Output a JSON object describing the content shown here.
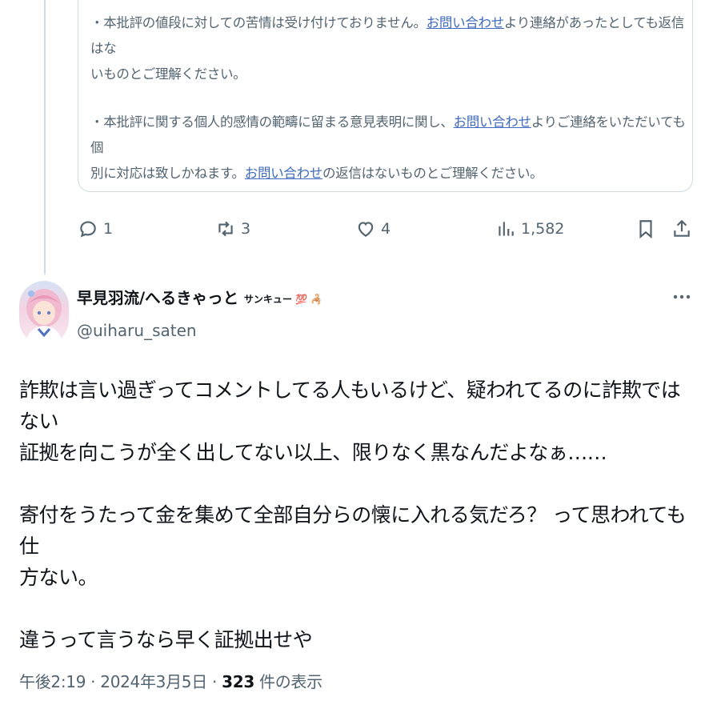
{
  "quoted_card": {
    "paragraph1": {
      "before": "・本批評の値段に対しての苦情は受け付けておりません。",
      "link": "お問い合わせ",
      "after_line1": "より連絡があったとしても返信はな",
      "line2": "いものとご理解ください。"
    },
    "paragraph2": {
      "before": "・本批評に関する個人的感情の範疇に留まる意見表明に関し、",
      "link1": "お問い合わせ",
      "after_line1": "よりご連絡をいただいても個",
      "line2_before": "別に対応は致しかねます。",
      "link2": "お問い合わせ",
      "line2_after": "の返信はないものとご理解ください。"
    }
  },
  "actions": {
    "reply_count": "1",
    "repost_count": "3",
    "like_count": "4",
    "views_count": "1,582"
  },
  "tweet": {
    "display_name": "早見羽流/へるきゃっと",
    "name_emoji": "サンキュー 💯 🦂",
    "handle": "@uiharu_saten",
    "paragraphs": [
      [
        "詐欺は言い過ぎってコメントしてる人もいるけど、疑われてるのに詐欺ではない",
        "証拠を向こうが全く出してない以上、限りなく黒なんだよなぁ……"
      ],
      [
        "寄付をうたって金を集めて全部自分らの懐に入れる気だろ？ って思われても仕",
        "方ない。"
      ],
      [
        "違うって言うなら早く証拠出せや"
      ]
    ],
    "timestamp": "午後2:19 · 2024年3月5日 · ",
    "views_number": "323",
    "views_label": " 件の表示"
  },
  "icons": [
    "reply-icon",
    "repost-icon",
    "like-icon",
    "views-icon",
    "bookmark-icon",
    "share-icon",
    "more-icon"
  ]
}
